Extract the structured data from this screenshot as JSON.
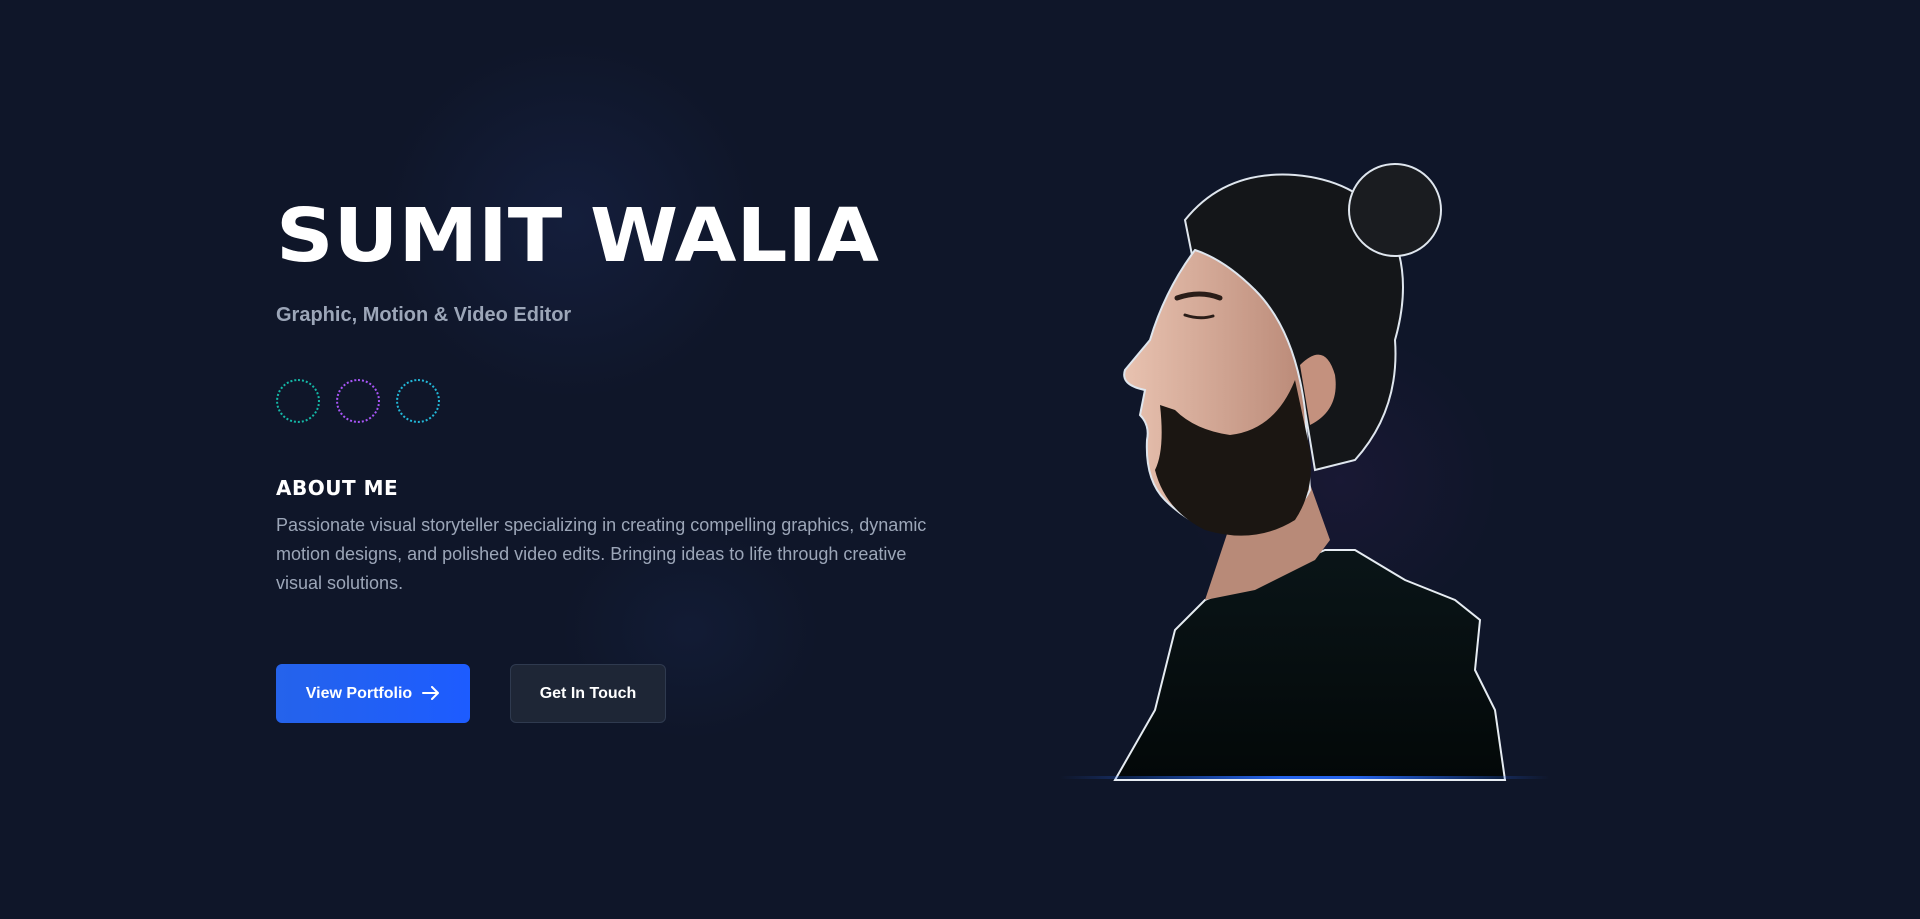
{
  "hero": {
    "name": "SUMIT WALIA",
    "role": "Graphic, Motion & Video Editor"
  },
  "socials": [
    {
      "icon": "social-link-ring",
      "color": "#14b8a6"
    },
    {
      "icon": "social-link-ring",
      "color": "#a855f7"
    },
    {
      "icon": "social-link-ring",
      "color": "#22b8d8"
    }
  ],
  "about": {
    "heading": "ABOUT ME",
    "text": "Passionate visual storyteller specializing in creating compelling graphics, dynamic motion designs, and polished video edits. Bringing ideas to life through creative visual solutions."
  },
  "actions": {
    "primary_label": "View Portfolio",
    "primary_icon": "arrow-right-icon",
    "secondary_label": "Get In Touch"
  },
  "theme": {
    "background": "#0f1629",
    "accent": "#1d5cff"
  }
}
